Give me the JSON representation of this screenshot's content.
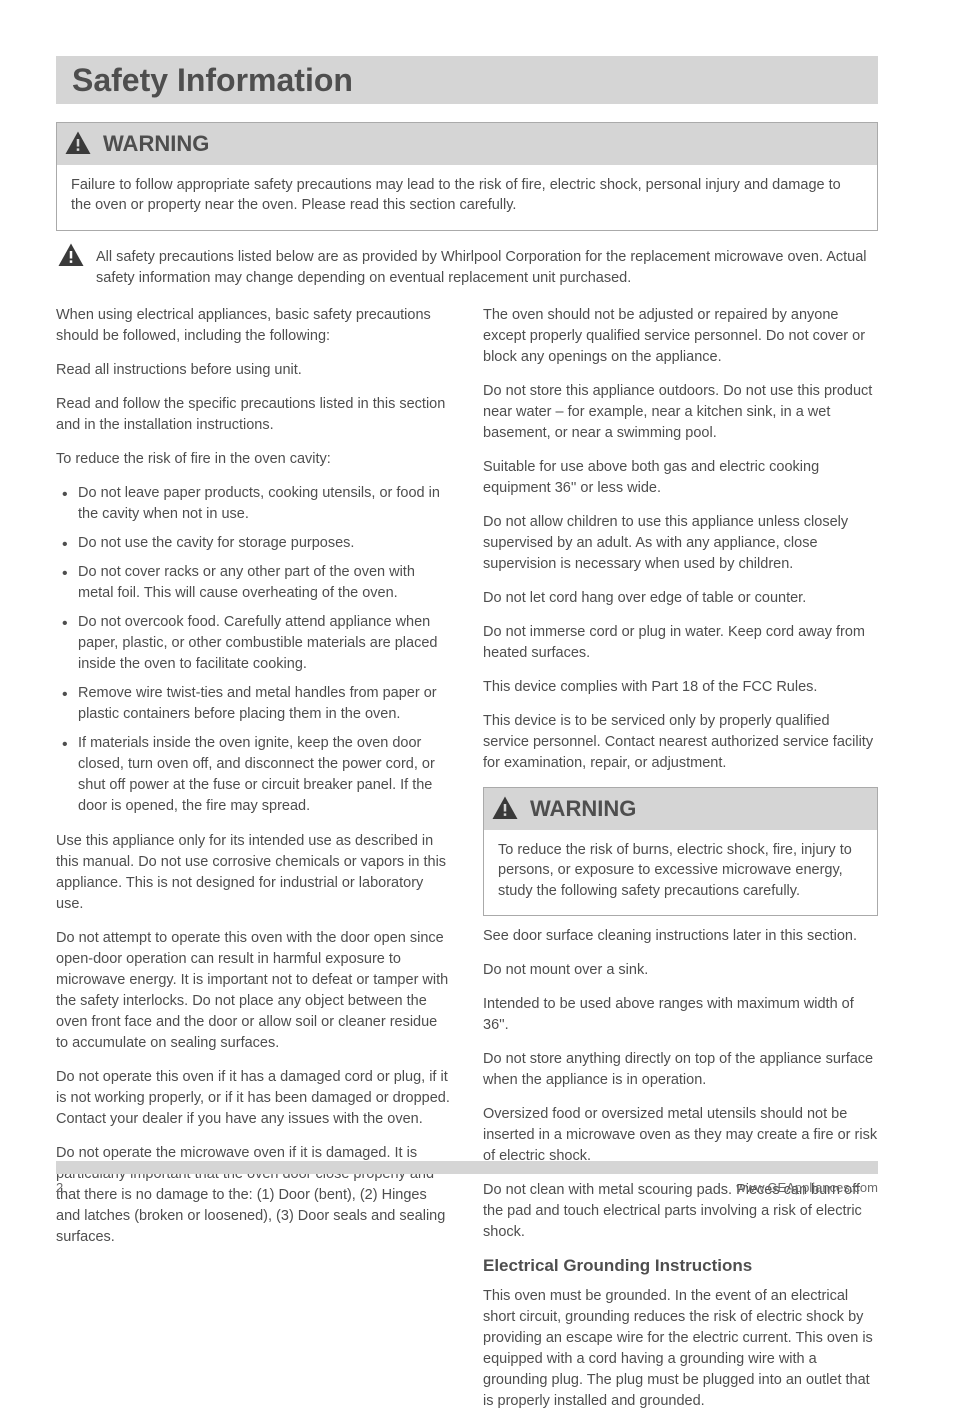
{
  "title": "Safety Information",
  "warning_label": "WARNING",
  "top_warning_body": "Failure to follow appropriate safety precautions may lead to the risk of fire, electric shock, personal injury and damage to the oven or property near the oven. Please read this section carefully.",
  "inline_warning": "All safety precautions listed below are as provided by Whirlpool Corporation for the replacement microwave oven.  Actual safety information may change depending on eventual replacement unit purchased.",
  "left": {
    "p1": "When using electrical appliances, basic safety precautions should be followed, including the following:",
    "p2": "Read all instructions before using unit.",
    "p3": "Read and follow the specific precautions listed in this section and in the installation instructions.",
    "p4": "To reduce the risk of fire in the oven cavity:",
    "bullets1": [
      "Do not leave paper products, cooking utensils, or food in the cavity when not in use.",
      "Do not use the cavity for storage purposes.",
      "Do not cover racks or any other part of the oven with metal foil.  This will cause overheating of the oven.",
      "Do not overcook food.  Carefully attend appliance when paper, plastic, or other combustible materials are placed inside the oven to facilitate cooking.",
      "Remove wire twist-ties and metal handles from paper or plastic containers before placing them in the oven.",
      "If materials inside the oven ignite, keep the oven door closed, turn oven off, and disconnect the power cord, or shut off power at the fuse or circuit breaker panel.  If the door is opened, the fire may spread."
    ],
    "p5": "Use this appliance only for its intended use as described in this manual.  Do not use corrosive chemicals or vapors in this appliance.  This is not designed for industrial or laboratory use.",
    "p6": "Do not attempt to operate this oven with the door open since open-door operation can result in harmful exposure to microwave energy.  It is important not to defeat or tamper with the safety interlocks.  Do not place any object between the oven front face and the door or allow soil or cleaner residue to accumulate on sealing surfaces.",
    "p7": "Do not operate this oven if it has a damaged cord or plug, if it is not working properly, or if it has been damaged or dropped.  Contact your dealer if you have any issues with the oven.",
    "p8": "Do not operate the microwave oven if it is damaged. It is particularly important that the oven door close properly and that there is no damage to the: (1) Door (bent), (2) Hinges and latches (broken or loosened), (3) Door seals and sealing surfaces."
  },
  "right": {
    "p1": "The oven should not be adjusted or repaired by anyone except properly qualified service personnel.  Do not cover or block any openings on the appliance.",
    "p2": "Do not store this appliance outdoors. Do not use this product near water – for example, near a kitchen sink, in a wet basement, or near a swimming pool.",
    "p3": "Suitable for use above both gas and electric cooking equipment 36'' or less wide.",
    "p4": "Do not allow children to use this appliance unless closely supervised by an adult. As with any appliance, close supervision is necessary when used by children.",
    "p5": "Do not let cord hang over edge of table or counter.",
    "p6": "Do not immerse cord or plug in water.  Keep cord away from heated surfaces.",
    "p7": "This device complies with Part 18 of the FCC Rules.",
    "p8": "This device is to be serviced only by properly qualified service personnel.  Contact nearest authorized service facility for examination, repair, or adjustment.",
    "warning_body": "To reduce the risk of burns, electric shock, fire, injury to persons, or exposure to excessive microwave energy, study the following safety precautions carefully.",
    "p9": "See door surface cleaning instructions later in this section.",
    "p10": "Do not mount over a sink.",
    "p11": "Intended to be used above ranges with maximum width of 36''.",
    "p12": "Do not store anything directly on top of the appliance surface when the appliance is in operation.",
    "p13": "Oversized food or oversized metal utensils should not be inserted in a microwave oven as they may create a fire or risk of electric shock.",
    "p14": "Do not clean with metal scouring pads.  Pieces can burn off the pad and touch electrical parts involving a risk of electric shock.",
    "head_grounding": "Electrical Grounding Instructions",
    "p15": "This oven must be grounded.  In the event of an electrical short circuit, grounding reduces the risk of electric shock by providing an escape wire for the electric current.  This oven is equipped with a cord having a grounding wire with a grounding plug.  The plug must be plugged into an outlet that is properly installed and grounded."
  },
  "footer": {
    "left": "2",
    "right": "www.GEAppliances.com"
  }
}
